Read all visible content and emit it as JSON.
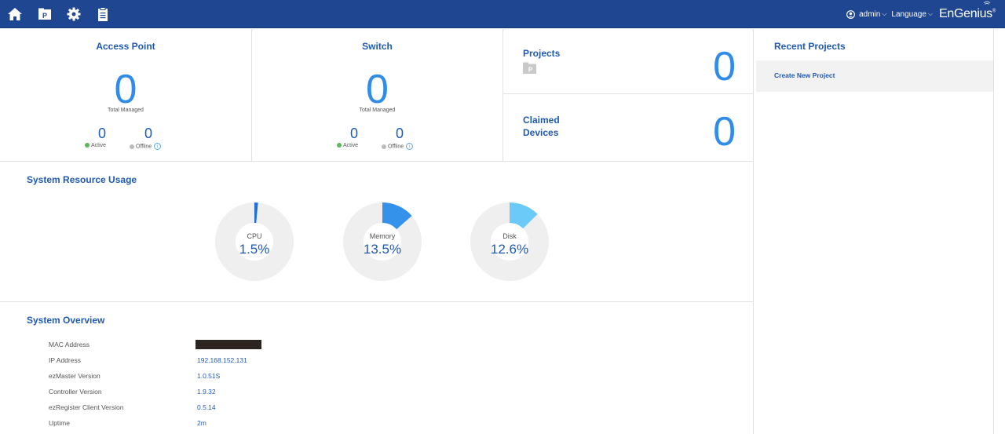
{
  "topbar": {
    "user": "admin",
    "language": "Language",
    "brand": "EnGenius",
    "brand_mark": "®"
  },
  "access_point": {
    "title": "Access Point",
    "total": "0",
    "total_label": "Total Managed",
    "active": "0",
    "active_label": "Active",
    "offline": "0",
    "offline_label": "Offline"
  },
  "switch": {
    "title": "Switch",
    "total": "0",
    "total_label": "Total Managed",
    "active": "0",
    "active_label": "Active",
    "offline": "0",
    "offline_label": "Offline"
  },
  "projects": {
    "title": "Projects",
    "count": "0"
  },
  "claimed": {
    "title_line1": "Claimed",
    "title_line2": "Devices",
    "count": "0"
  },
  "resource": {
    "title": "System Resource Usage",
    "gauges": [
      {
        "label": "CPU",
        "value": "1.5%",
        "fraction": 0.015,
        "color": "#1f6fd6"
      },
      {
        "label": "Memory",
        "value": "13.5%",
        "fraction": 0.135,
        "color": "#3592ea"
      },
      {
        "label": "Disk",
        "value": "12.6%",
        "fraction": 0.126,
        "color": "#6ccaf8"
      }
    ]
  },
  "overview": {
    "title": "System Overview",
    "rows": [
      {
        "label": "MAC Address",
        "value": ""
      },
      {
        "label": "IP Address",
        "value": "192.168.152.131"
      },
      {
        "label": "ezMaster Version",
        "value": "1.0.51S"
      },
      {
        "label": "Controller Version",
        "value": "1.9.32"
      },
      {
        "label": "ezRegister Client Version",
        "value": "0.5.14"
      },
      {
        "label": "Uptime",
        "value": "2m"
      }
    ]
  },
  "recent": {
    "title": "Recent Projects",
    "create_label": "Create New Project"
  },
  "colors": {
    "header": "#1f4690",
    "accent": "#1f5ab3",
    "big_number": "#2f8ce8",
    "active": "#5cb85c",
    "offline": "#bbbbbb"
  }
}
